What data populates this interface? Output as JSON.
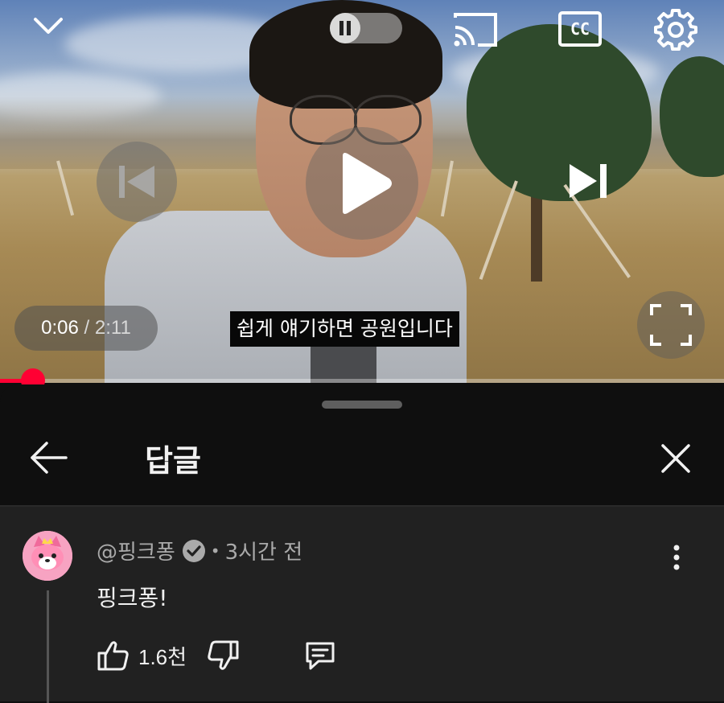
{
  "video": {
    "current_time": "0:06",
    "separator": "/",
    "duration": "2:11",
    "subtitle": "쉽게 얘기하면 공원입니다",
    "progress_fraction": 0.046,
    "controls": {
      "collapse_icon": "chevron-down-icon",
      "pause_toggle_icon": "pause-icon",
      "cast_icon": "cast-icon",
      "captions_label": "CC",
      "settings_icon": "gear-icon",
      "previous_icon": "skip-previous-icon",
      "play_icon": "play-icon",
      "next_icon": "skip-next-icon",
      "fullscreen_icon": "fullscreen-icon"
    },
    "accent_color": "#ff0033"
  },
  "panel": {
    "title": "답글",
    "back_icon": "arrow-left-icon",
    "close_icon": "close-icon"
  },
  "comment": {
    "author": "@핑크퐁",
    "verified_icon": "verified-check-icon",
    "bullet": "•",
    "time": "3시간 전",
    "text": "핑크퐁!",
    "like_count": "1.6천",
    "like_icon": "thumbs-up-icon",
    "dislike_icon": "thumbs-down-icon",
    "reply_icon": "reply-comment-icon",
    "more_icon": "more-vertical-icon"
  }
}
